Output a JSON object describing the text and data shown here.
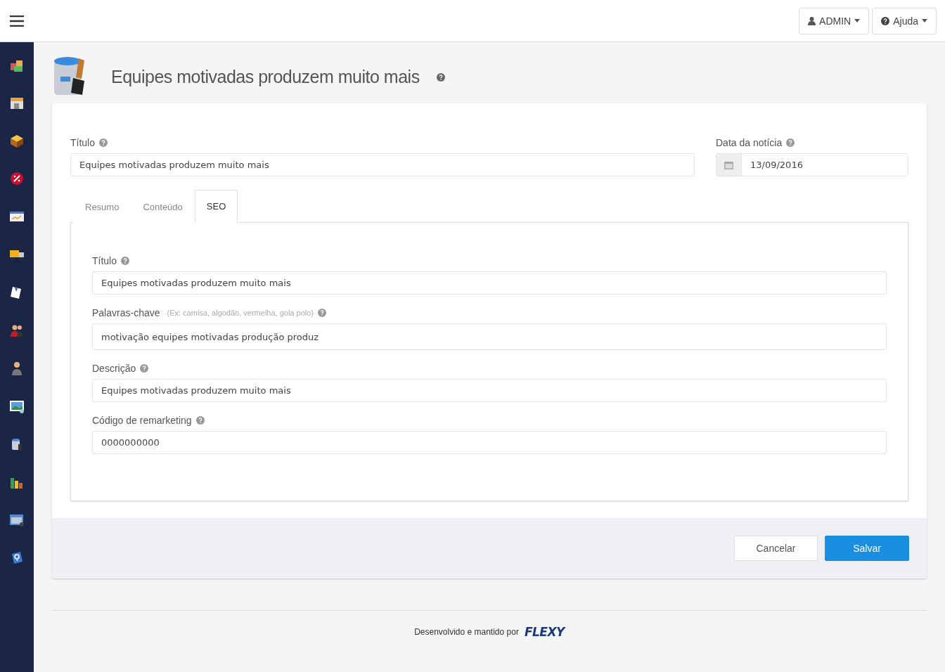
{
  "topbar": {
    "user_menu": "ADMIN",
    "help_menu": "Ajuda"
  },
  "page": {
    "title": "Equipes motivadas produzem muito mais"
  },
  "main_fields": [
    {
      "kind": "text",
      "label": "Título",
      "value": "Equipes motivadas produzem muito mais"
    },
    {
      "kind": "date",
      "label": "Data da notícia",
      "value": "13/09/2016"
    }
  ],
  "tabs": [
    {
      "label": "Resumo",
      "selected": false
    },
    {
      "label": "Conteúdo",
      "selected": false
    },
    {
      "label": "SEO",
      "selected": true
    }
  ],
  "seo_fields": [
    {
      "label": "Título",
      "value": "Equipes motivadas produzem muito mais"
    },
    {
      "label": "Palavras-chave",
      "hint": "(Ex: camisa, algodão, vermelha, gola polo)",
      "value": "motivação equipes motivadas produção produz"
    },
    {
      "label": "Descrição",
      "value": "Equipes motivadas produzem muito mais"
    },
    {
      "label": "Código de remarketing",
      "value": "0000000000"
    }
  ],
  "buttons": [
    {
      "label": "Cancelar",
      "kind": "secondary"
    },
    {
      "label": "Salvar",
      "kind": "primary"
    }
  ],
  "footer": {
    "text": "Desenvolvido e mantido por",
    "logo": "FLEXY"
  }
}
